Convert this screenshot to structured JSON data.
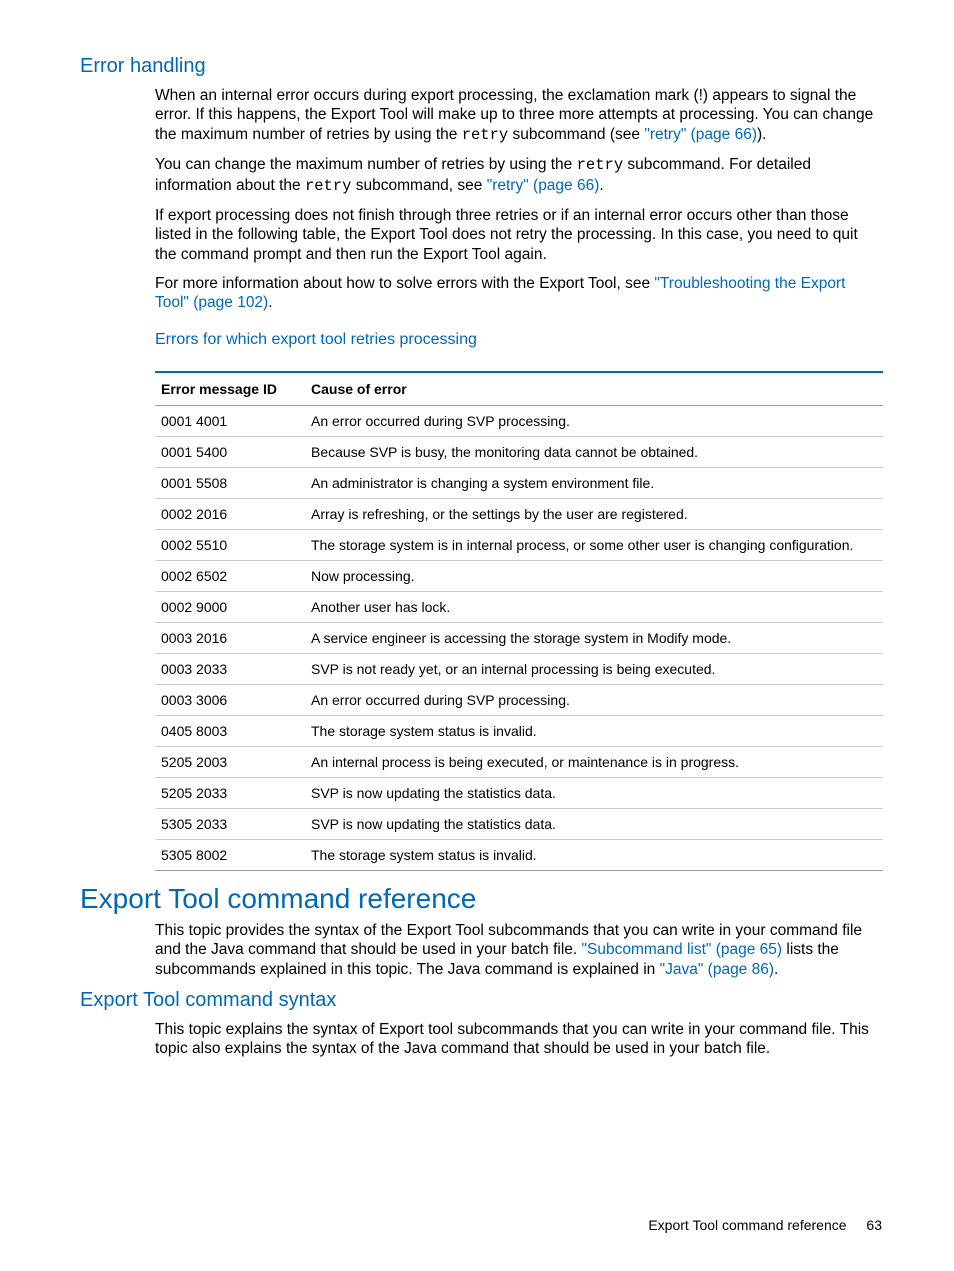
{
  "h_error_handling": "Error handling",
  "p1_a": "When an internal error occurs during export processing, the exclamation mark (!) appears to signal the error. If this happens, the Export Tool will make up to three more attempts at processing. You can change the maximum number of retries by using the ",
  "p1_code": "retry",
  "p1_b": " subcommand (see ",
  "p1_link": "\"retry\" (page 66)",
  "p1_c": ").",
  "p2_a": "You can change the maximum number of retries by using the ",
  "p2_code1": "retry",
  "p2_b": " subcommand. For detailed information about the ",
  "p2_code2": "retry",
  "p2_c": " subcommand, see ",
  "p2_link": "\"retry\" (page 66)",
  "p2_d": ".",
  "p3": "If export processing does not finish through three retries or if an internal error occurs other than those listed in the following table, the Export Tool does not retry the processing. In this case, you need to quit the command prompt and then run the Export Tool again.",
  "p4_a": "For more information about how to solve errors with the Export Tool, see ",
  "p4_link": "\"Troubleshooting the Export Tool\" (page 102)",
  "p4_b": ".",
  "table_title": "Errors for which export tool retries processing",
  "table": {
    "headers": [
      "Error message ID",
      "Cause of error"
    ],
    "rows": [
      [
        "0001 4001",
        "An error occurred during SVP processing."
      ],
      [
        "0001 5400",
        "Because SVP is busy, the monitoring data cannot be obtained."
      ],
      [
        "0001 5508",
        "An administrator is changing a system environment file."
      ],
      [
        "0002 2016",
        "Array is refreshing, or the settings by the user are registered."
      ],
      [
        "0002 5510",
        "The storage system is in internal process, or some other user is changing configuration."
      ],
      [
        "0002 6502",
        "Now processing."
      ],
      [
        "0002 9000",
        "Another user has lock."
      ],
      [
        "0003 2016",
        "A service engineer is accessing the storage system in Modify mode."
      ],
      [
        "0003 2033",
        "SVP is not ready yet, or an internal processing is being executed."
      ],
      [
        "0003 3006",
        "An error occurred during SVP processing."
      ],
      [
        "0405 8003",
        "The storage system status is invalid."
      ],
      [
        "5205 2003",
        "An internal process is being executed, or maintenance is in progress."
      ],
      [
        "5205 2033",
        "SVP is now updating the statistics data."
      ],
      [
        "5305 2033",
        "SVP is now updating the statistics data."
      ],
      [
        "5305 8002",
        "The storage system status is invalid."
      ]
    ]
  },
  "h_cmd_ref": "Export Tool command reference",
  "p5_a": "This topic provides the syntax of the Export Tool subcommands that you can write in your command file and the Java command that should be used in your batch file. ",
  "p5_link1": "\"Subcommand list\" (page 65)",
  "p5_b": " lists the subcommands explained in this topic. The Java command is explained in ",
  "p5_link2": "\"Java\" (page 86)",
  "p5_c": ".",
  "h_cmd_syntax": "Export Tool command syntax",
  "p6": "This topic explains the syntax of Export tool subcommands that you can write in your command file. This topic also explains the syntax of the Java command that should be used in your batch file.",
  "footer_text": "Export Tool command reference",
  "footer_page": "63"
}
